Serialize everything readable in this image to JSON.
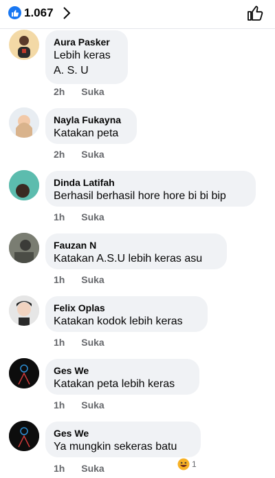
{
  "header": {
    "like_count": "1.067"
  },
  "comments": [
    {
      "author": "Aura Pasker",
      "text": "Lebih keras\nA.  S.  U",
      "time": "2h",
      "action": "Suka"
    },
    {
      "author": "Nayla Fukayna",
      "text": "Katakan peta",
      "time": "2h",
      "action": "Suka"
    },
    {
      "author": "Dinda Latifah",
      "text": "Berhasil berhasil hore hore bi bi bip",
      "time": "1h",
      "action": "Suka"
    },
    {
      "author": "Fauzan N",
      "text": "Katakan A.S.U lebih keras asu",
      "time": "1h",
      "action": "Suka"
    },
    {
      "author": "Felix Oplas",
      "text": "Katakan kodok lebih keras",
      "time": "1h",
      "action": "Suka"
    },
    {
      "author": "Ges We",
      "text": "Katakan peta lebih keras",
      "time": "1h",
      "action": "Suka"
    },
    {
      "author": "Ges We",
      "text": "Ya mungkin sekeras batu",
      "time": "1h",
      "action": "Suka",
      "reaction_count": "1"
    }
  ],
  "colors": {
    "accent": "#1877f2",
    "bubble": "#f0f2f5",
    "meta": "#65676b"
  }
}
